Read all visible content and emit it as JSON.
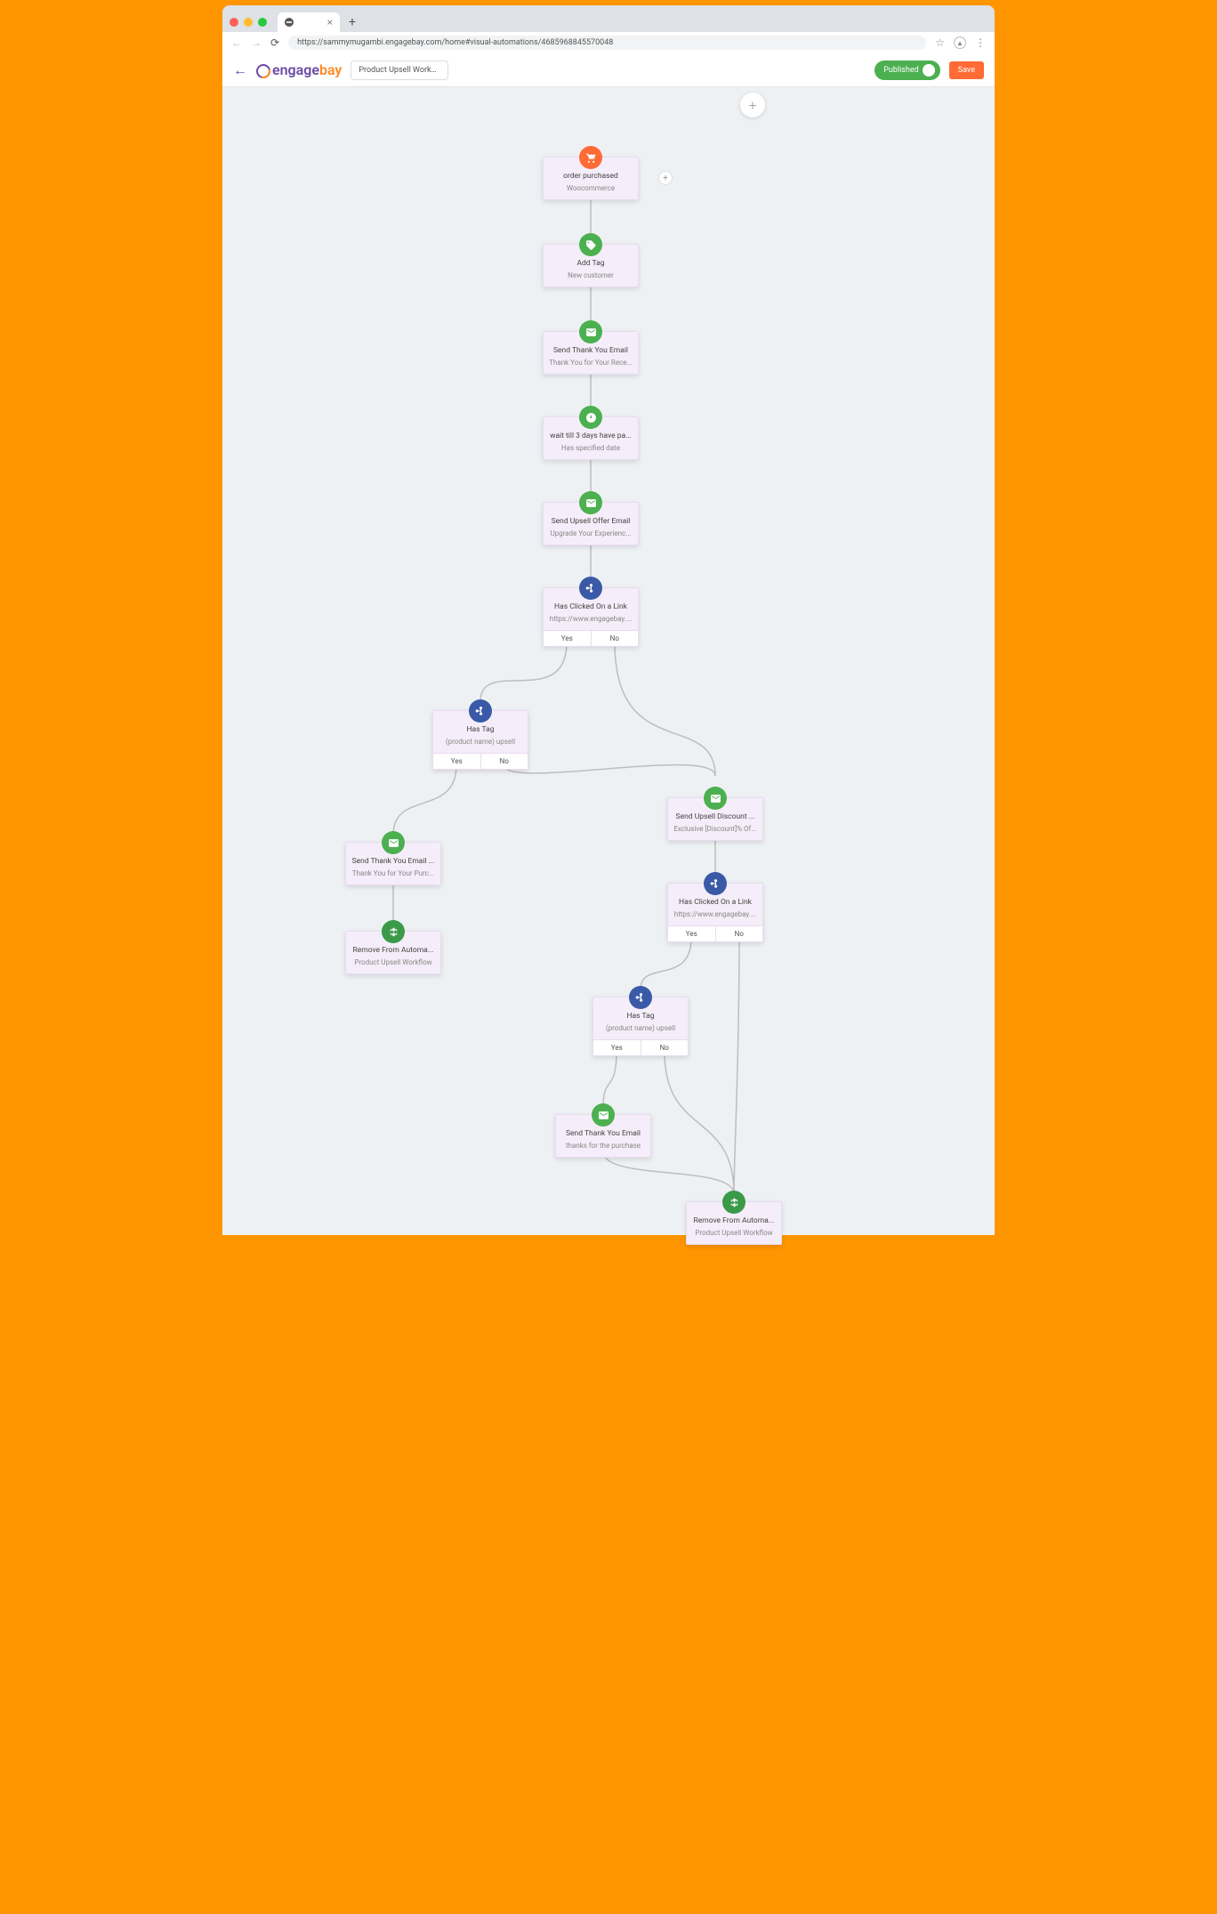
{
  "browser": {
    "url": "https://sammymugambi.engagebay.com/home#visual-automations/4685968845570048"
  },
  "header": {
    "logo_part1": "engage",
    "logo_part2": "bay",
    "workflow_name": "Product Upsell Workflow",
    "published_label": "Published",
    "save_label": "Save"
  },
  "branches": {
    "yes": "Yes",
    "no": "No"
  },
  "nodes": {
    "n1": {
      "title": "order purchased",
      "sub": "Woocommerce"
    },
    "n2": {
      "title": "Add Tag",
      "sub": "New customer"
    },
    "n3": {
      "title": "Send Thank You Email",
      "sub": "Thank You for Your Rece..."
    },
    "n4": {
      "title": "wait till 3 days have pa...",
      "sub": "Has specified date"
    },
    "n5": {
      "title": "Send Upsell Offer Email",
      "sub": "Upgrade Your Experienc..."
    },
    "n6": {
      "title": "Has Clicked On a Link",
      "sub": "https://www.engagebay...."
    },
    "n7": {
      "title": "Has Tag",
      "sub": "(product name) upsell"
    },
    "n8": {
      "title": "Send Thank You Email ...",
      "sub": "Thank You for Your Purc..."
    },
    "n9": {
      "title": "Remove From Automa...",
      "sub": "Product Upsell Workflow"
    },
    "n10": {
      "title": "Send Upsell Discount ...",
      "sub": "Exclusive [Discount]% Of..."
    },
    "n11": {
      "title": "Has Clicked On a Link",
      "sub": "https://www.engagebay...."
    },
    "n12": {
      "title": "Has Tag",
      "sub": "(product name) upsell"
    },
    "n13": {
      "title": "Send Thank You Email",
      "sub": "thanks for the purchase"
    },
    "n14": {
      "title": "Remove From Automa...",
      "sub": "Product Upsell Workflow"
    }
  }
}
